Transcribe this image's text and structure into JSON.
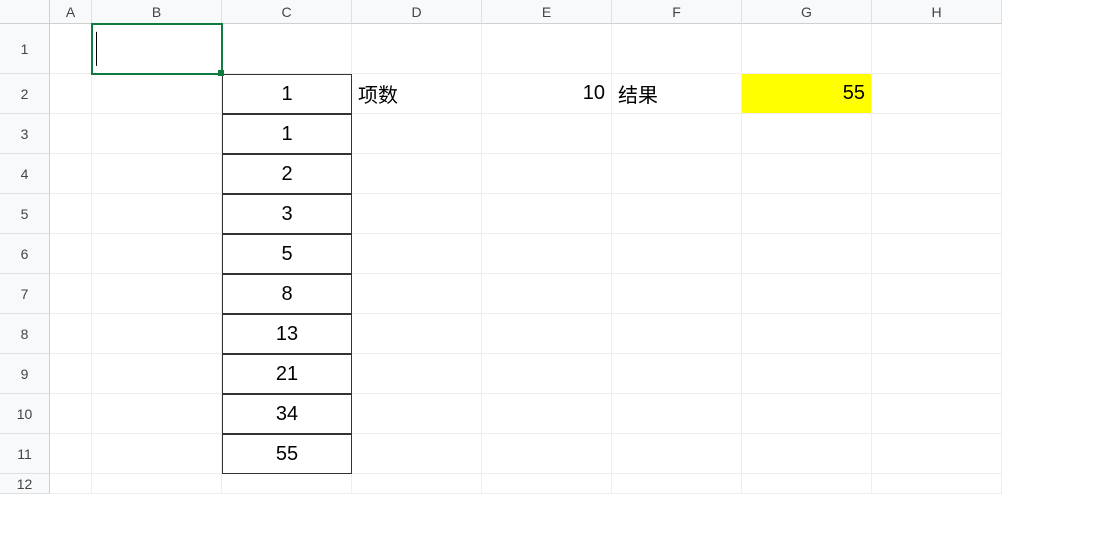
{
  "columns": [
    "A",
    "B",
    "C",
    "D",
    "E",
    "F",
    "G",
    "H"
  ],
  "rows": [
    "1",
    "2",
    "3",
    "4",
    "5",
    "6",
    "7",
    "8",
    "9",
    "10",
    "11",
    "12"
  ],
  "active_cell": "B1",
  "data": {
    "C2": "1",
    "C3": "1",
    "C4": "2",
    "C5": "3",
    "C6": "5",
    "C7": "8",
    "C8": "13",
    "C9": "21",
    "C10": "34",
    "C11": "55",
    "D2": "项数",
    "E2": "10",
    "F2": "结果",
    "G2": "55"
  }
}
